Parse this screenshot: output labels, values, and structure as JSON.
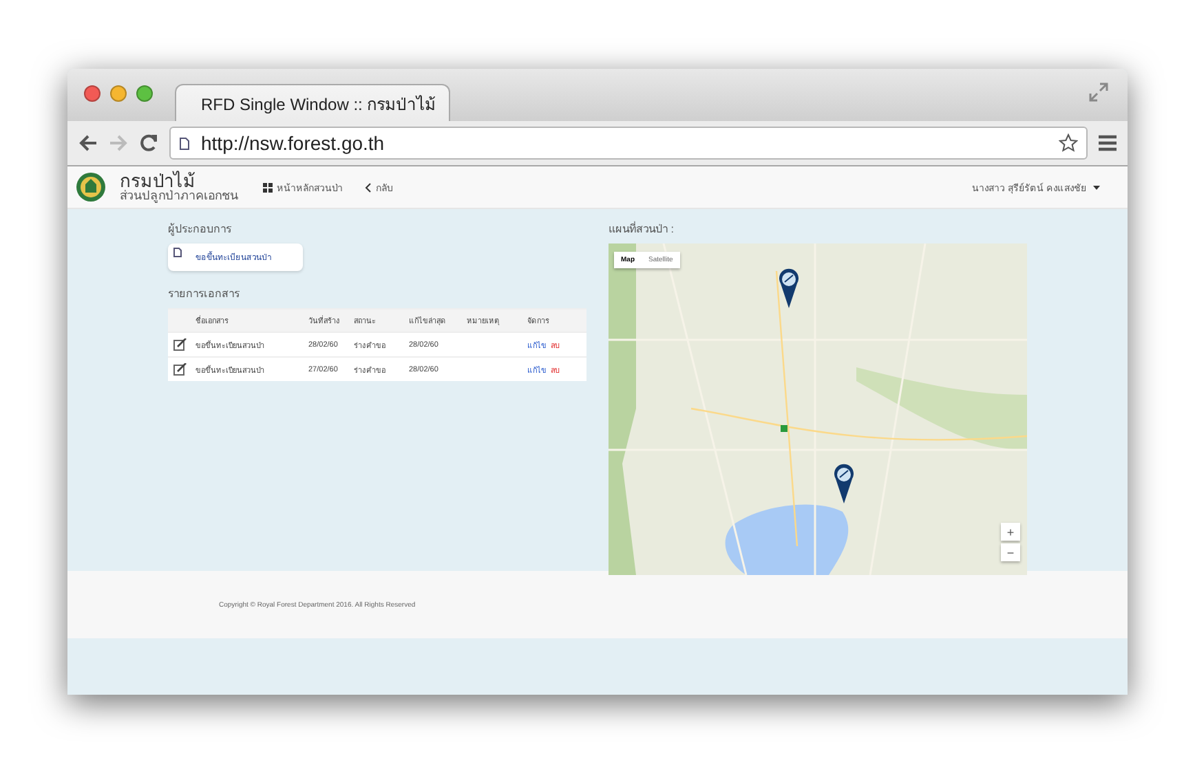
{
  "browser": {
    "tab_title": "RFD Single Window :: กรมป่าไม้",
    "url": "http://nsw.forest.go.th"
  },
  "navbar": {
    "brand": "กรมป่าไม้",
    "subtitle": "ส่วนปลูกป่าภาคเอกชน",
    "links": [
      {
        "label": "หน้าหลักสวนป่า"
      },
      {
        "label": "กลับ"
      }
    ],
    "user": "นางสาว สุรีย์รัตน์ คงแสงชัย"
  },
  "operator": {
    "heading": "ผู้ประกอบการ",
    "action": "ขอขึ้นทะเบียนสวนป่า"
  },
  "documents": {
    "heading": "รายการเอกสาร",
    "columns": [
      "ชื่อเอกสาร",
      "วันที่สร้าง",
      "สถานะ",
      "แก้ไขล่าสุด",
      "หมายเหตุ",
      "จัดการ"
    ],
    "rows": [
      {
        "name": "ขอขึ้นทะเบียนสวนป่า",
        "created": "28/02/60",
        "status": "ร่างคำขอ",
        "modified": "28/02/60",
        "edit": "แก้ไข",
        "delete": "ลบ"
      },
      {
        "name": "ขอขึ้นทะเบียนสวนป่า",
        "created": "27/02/60",
        "status": "ร่างคำขอ",
        "modified": "28/02/60",
        "edit": "แก้ไข",
        "delete": "ลบ"
      }
    ]
  },
  "map": {
    "heading": "แผนที่สวนป่า :",
    "types": [
      {
        "label": "Map",
        "selected": true
      },
      {
        "label": "Satellite",
        "selected": false
      }
    ],
    "zoom": [
      "+",
      "−"
    ]
  },
  "footer": {
    "copyright": "Copyright © Royal Forest Department 2016. All Rights Reserved"
  }
}
